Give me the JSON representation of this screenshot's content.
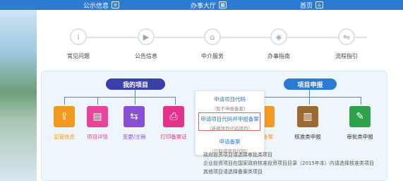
{
  "topbar": {
    "items": [
      {
        "label": "公示信息",
        "icon": "notice-icon"
      },
      {
        "label": "办事大厅",
        "icon": "building-icon"
      },
      {
        "label": "首页",
        "icon": "home-icon"
      }
    ]
  },
  "steps": [
    {
      "label": "常见问题",
      "icon": "info-icon"
    },
    {
      "label": "公告信息",
      "icon": "play-icon"
    },
    {
      "label": "中介服务",
      "icon": "bank-icon"
    },
    {
      "label": "办事指南",
      "icon": "compass-icon"
    },
    {
      "label": "流程指引",
      "icon": "flow-icon"
    }
  ],
  "my_projects": {
    "title": "我的项目"
  },
  "project_apply": {
    "title": "项目申报"
  },
  "left_tiles": [
    {
      "label": "监管信息",
      "color": "#f29a1f",
      "icon": "upload-icon"
    },
    {
      "label": "项目详情",
      "color": "#e8459a",
      "icon": "file-icon"
    },
    {
      "label": "变更/注销",
      "color": "#8a4fd6",
      "icon": "transfer-icon"
    },
    {
      "label": "打印备案证",
      "color": "#e4318a",
      "icon": "printer-icon"
    }
  ],
  "right_tiles": [
    {
      "label": "备案",
      "color": "#f29a1f",
      "icon": "doc-icon"
    },
    {
      "label": "核准类申报",
      "color": "#9b6a33",
      "icon": "document-icon"
    },
    {
      "label": "审批类申报",
      "color": "#2da24a",
      "icon": "edit-icon"
    }
  ],
  "popup": {
    "items": [
      {
        "title": "申请项目代码",
        "sub": "（暂不申报备案）"
      },
      {
        "title": "申请项目代码并申报备案",
        "sub": "（新建项目代码项目）"
      },
      {
        "title": "申请备案",
        "sub": "（已取得项目代码）"
      }
    ]
  },
  "notes": [
    "政府投资项目请选择审批类项目",
    "企业投资项目在国家政府核准投资项目目录（2015年本）内请选择核准类项目",
    "其他项目请选择备案类项目"
  ]
}
